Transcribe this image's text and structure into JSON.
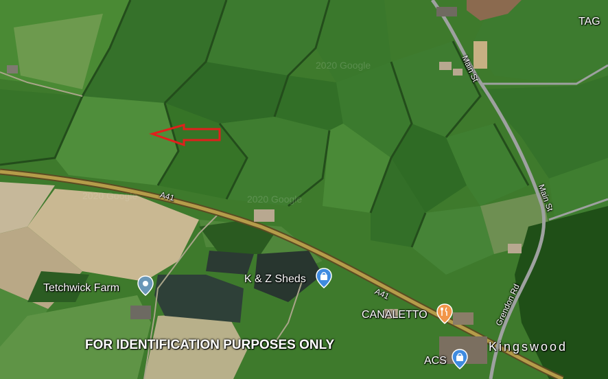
{
  "map": {
    "watermarks": [
      "2020 Google",
      "2020 Google",
      "2020 Google"
    ],
    "places": {
      "tetchwick_farm": "Tetchwick Farm",
      "kz_sheds": "K & Z Sheds",
      "canaletto": "CANALETTO",
      "acs": "ACS",
      "kingswood": "Kingswood",
      "tag": "TAG"
    },
    "roads": {
      "a41_west": "A41",
      "a41_east": "A41",
      "main_st_north": "Main St",
      "main_st_south": "Main St",
      "grendon_rd": "Grendon Rd"
    },
    "banner": "FOR IDENTIFICATION PURPOSES ONLY",
    "colors": {
      "arrow": "#e0201c",
      "pin_place": "#6a97b8",
      "pin_shop": "#3f8be0",
      "pin_food": "#f2964a"
    }
  }
}
